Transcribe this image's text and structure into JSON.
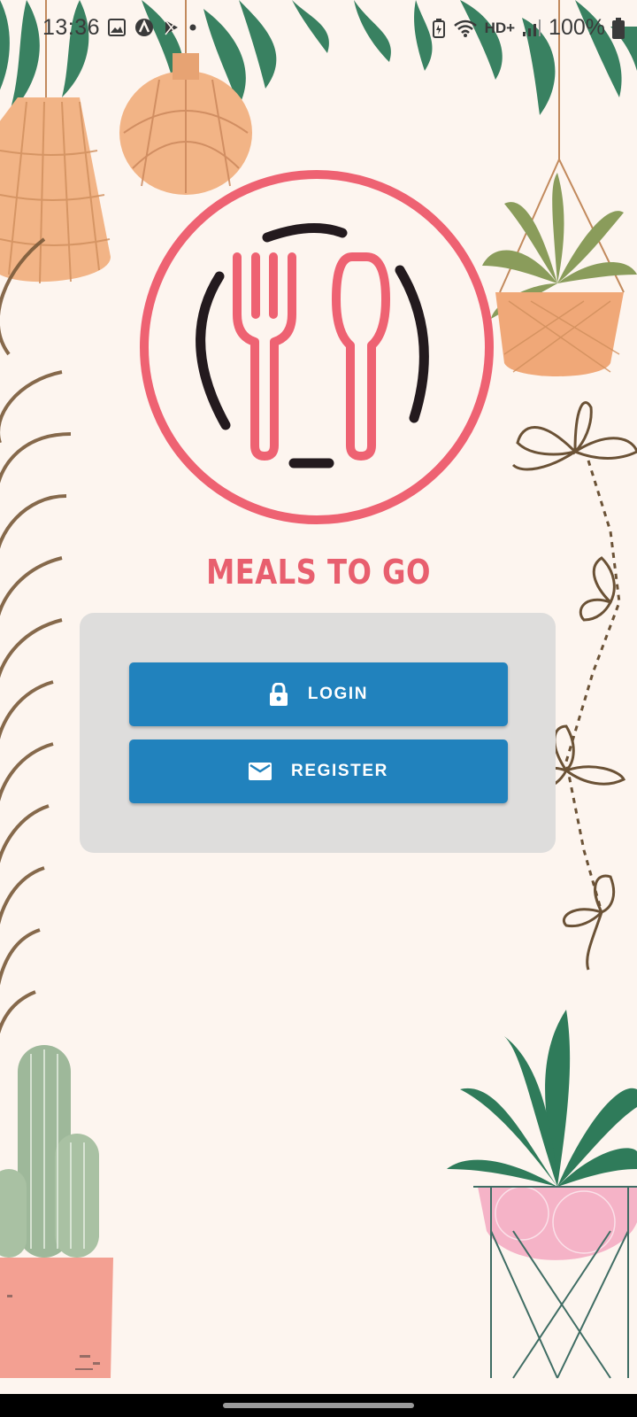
{
  "status_bar": {
    "time": "13:36",
    "battery": "100%",
    "network": "HD+"
  },
  "app": {
    "title": "MEALS TO GO"
  },
  "account": {
    "login_label": "LOGIN",
    "register_label": "REGISTER"
  },
  "colors": {
    "background": "#fdf5ef",
    "brand": "#e85f6e",
    "button": "#2182bd",
    "card": "#dedddc"
  },
  "icons": {
    "login": "lock-icon",
    "register": "mail-icon",
    "logo": "fork-spoon-plate-icon"
  }
}
